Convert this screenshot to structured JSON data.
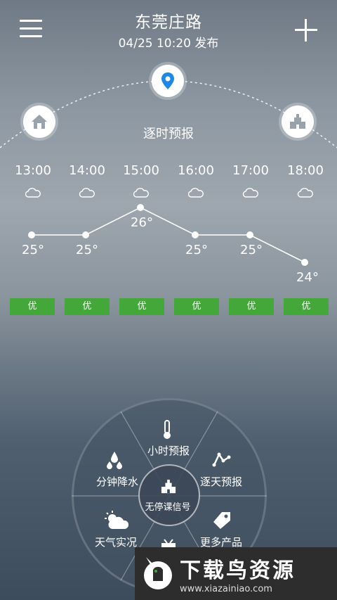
{
  "header": {
    "title": "东莞庄路",
    "publish": "04/25  10:20 发布"
  },
  "section_title": "逐时预报",
  "hours": [
    "13:00",
    "14:00",
    "15:00",
    "16:00",
    "17:00",
    "18:00"
  ],
  "temps": [
    "25°",
    "25°",
    "26°",
    "25°",
    "25°",
    "24°"
  ],
  "temp_values": [
    25,
    25,
    26,
    25,
    25,
    24
  ],
  "aqi": [
    "优",
    "优",
    "优",
    "优",
    "优",
    "优"
  ],
  "menu": {
    "hourly": "小时预报",
    "daily": "逐天预报",
    "minute_rain": "分钟降水",
    "live": "天气实况",
    "more": "更多产品",
    "center": "无停课信号"
  },
  "banner": {
    "title": "下载鸟资源",
    "url": "www.xiazainiao.com"
  },
  "colors": {
    "aqi_good": "#43a73a",
    "pin_blue": "#1e88e5"
  },
  "icons": [
    "menu-icon",
    "add-icon",
    "home-icon",
    "location-pin-icon",
    "school-icon",
    "cloud-icon",
    "thermometer-icon",
    "trend-icon",
    "raindrop-icon",
    "partly-cloudy-icon",
    "tag-icon",
    "school-icon",
    "tv-icon"
  ]
}
